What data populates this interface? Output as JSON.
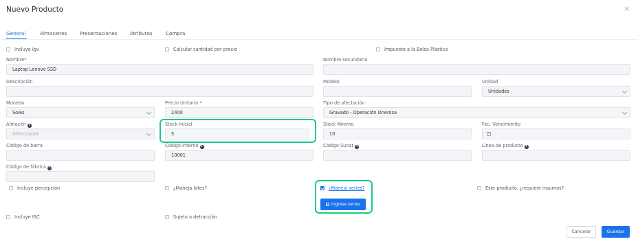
{
  "modal": {
    "title": "Nuevo Producto",
    "close_glyph": "×",
    "tabs": [
      {
        "label": "General",
        "active": true
      },
      {
        "label": "Almacenes",
        "active": false
      },
      {
        "label": "Presentaciones",
        "active": false
      },
      {
        "label": "Atributos",
        "active": false
      },
      {
        "label": "Compra",
        "active": false
      }
    ]
  },
  "checks": {
    "incluye_igv": {
      "label": "Incluye Igv",
      "checked": false
    },
    "calcular_cantidad": {
      "label": "Calcular cantidad por precio",
      "checked": false
    },
    "impuesto_bolsa": {
      "label": "Impuesto a la Bolsa Plástica",
      "checked": false
    },
    "incluye_percepcion": {
      "label": "Incluye percepción",
      "checked": false
    },
    "maneja_lotes": {
      "label": "¿Maneja lotes?",
      "checked": false
    },
    "maneja_series": {
      "label": "¿Maneja series?",
      "checked": true
    },
    "requiere_insumos": {
      "label": "Este producto, ¿requiere insumos?",
      "checked": false
    },
    "incluye_isc": {
      "label": "Incluye ISC",
      "checked": false
    },
    "sujeto_detraccion": {
      "label": "Sujeto a detracción",
      "checked": false
    }
  },
  "fields": {
    "nombre": {
      "label": "Nombre",
      "required_mark": "*",
      "value": "Laptop Lenovo  SSD"
    },
    "nombre_secundario": {
      "label": "Nombre secundario",
      "value": ""
    },
    "descripcion": {
      "label": "Descripción",
      "value": ""
    },
    "modelo": {
      "label": "Modelo",
      "value": ""
    },
    "unidad": {
      "label": "Unidad",
      "value": "Unidades"
    },
    "moneda": {
      "label": "Moneda",
      "value": "Soles"
    },
    "precio_unitario": {
      "label": "Precio Unitario",
      "required_mark": "*",
      "value": "2400"
    },
    "tipo_afectacion": {
      "label": "Tipo de afectación",
      "value": "Gravado - Operación Onerosa"
    },
    "almacen": {
      "label": "Almacén",
      "value": "Seleccionar"
    },
    "stock_inicial": {
      "label": "Stock Inicial",
      "value": "5"
    },
    "stock_minimo": {
      "label": "Stock Mínimo",
      "value": "10"
    },
    "fec_vencimiento": {
      "label": "Fec. Vencimiento",
      "value": ""
    },
    "codigo_barra": {
      "label": "Código de barra",
      "value": ""
    },
    "codigo_interno": {
      "label": "Código Interno",
      "value": "10001"
    },
    "codigo_sunat": {
      "label": "Código Sunat",
      "value": ""
    },
    "linea_producto": {
      "label": "Línea de producto",
      "value": ""
    },
    "codigo_fabrica": {
      "label": "Código de fábrica",
      "value": ""
    }
  },
  "buttons": {
    "ingrese_series": "Ingrese series",
    "cancelar": "Cancelar",
    "guardar": "Guardar"
  },
  "colors": {
    "accent": "#1a73e8",
    "highlight": "#19c98a",
    "required": "#e53935"
  }
}
